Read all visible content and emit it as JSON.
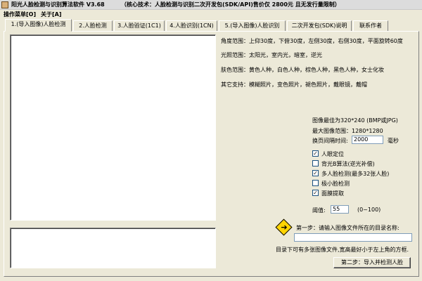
{
  "window": {
    "title": "阳光人脸检测与识别算法软件 V3.68",
    "banner": "（核心技术：人脸检测与识别二次开发包(SDK/API)售价仅 2800元 且无发行量限制）"
  },
  "menu": {
    "items": [
      "操作菜单[O]",
      "关于[A]"
    ]
  },
  "tabs": [
    "1.(导入图像)人脸检测",
    "2.人脸检测",
    "3.人脸验证(1C1)",
    "4.人脸识别(1CN)",
    "5.(导入图像)人脸识别",
    "二次开发包(SDK)说明",
    "联系作者"
  ],
  "active_tab": 0,
  "info": {
    "angle": "角度范围：上仰30度，下俯30度，左侧30度，右侧30度，平面旋转60度",
    "light": "光照范围：太阳光，室内光，暗室，逆光",
    "skin": "肤色范围：黄色人种，白色人种，棕色人种，黑色人种，女士化妆",
    "other": "其它支持：模糊照片，变色照片，褪色照片，戴眼镜，戴帽"
  },
  "specs": {
    "best_size": "图像最佳为320*240 (BMP或JPG)",
    "max_size": "最大图像范围：1280*1280",
    "interval_label": "换页间隔时间:",
    "interval_value": "2000",
    "interval_unit": "毫秒"
  },
  "options": [
    {
      "label": "人眼定位",
      "checked": true
    },
    {
      "label": "背光B算法(逆光补偿)",
      "checked": false
    },
    {
      "label": "多人脸检测(最多32张人脸)",
      "checked": true
    },
    {
      "label": "极小脸检测",
      "checked": false
    },
    {
      "label": "面膜提取",
      "checked": true
    }
  ],
  "threshold": {
    "label": "阈值:",
    "value": "55",
    "range": "(0~100)"
  },
  "step1": {
    "label": "第一步：请输入图像文件所在的目录名称:",
    "value": "",
    "note": "目录下可有多张图像文件,宽高最好小于左上角的方框."
  },
  "step2": {
    "button_label": "第二步：导入并检测人脸"
  },
  "icons": {
    "arrow": "arrow-right-icon"
  }
}
